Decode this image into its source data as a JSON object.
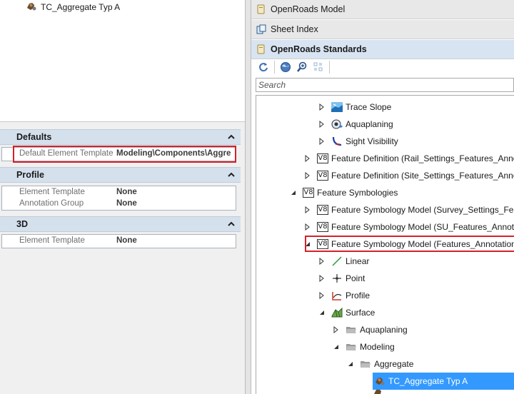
{
  "left_panel": {
    "top_item": {
      "label": "TC_Aggregate Typ A",
      "icon": "aggregate-icon"
    }
  },
  "properties": {
    "sections": [
      {
        "title": "Defaults",
        "rows": [
          {
            "label": "Default Element Template",
            "value": "Modeling\\Components\\Aggre"
          }
        ]
      },
      {
        "title": "Profile",
        "rows": [
          {
            "label": "Element Template",
            "value": "None"
          },
          {
            "label": "Annotation Group",
            "value": "None"
          }
        ]
      },
      {
        "title": "3D",
        "rows": [
          {
            "label": "Element Template",
            "value": "None"
          }
        ]
      }
    ]
  },
  "right_panel": {
    "tabs": [
      {
        "label": "OpenRoads Model",
        "icon": "dgn-file-icon"
      },
      {
        "label": "Sheet Index",
        "icon": "sheet-index-icon"
      },
      {
        "label": "OpenRoads Standards",
        "icon": "dgn-file-icon"
      }
    ],
    "toolbar": [
      "refresh-icon",
      "globe-icon",
      "zoom-icon",
      "grid-icon"
    ],
    "search_placeholder": "Search",
    "tree": [
      {
        "label": "Trace Slope",
        "icon": "trace-slope-icon",
        "expander": "collapsed"
      },
      {
        "label": "Aquaplaning",
        "icon": "aquaplaning-icon",
        "expander": "collapsed"
      },
      {
        "label": "Sight Visibility",
        "icon": "sight-visibility-icon",
        "expander": "collapsed"
      },
      {
        "label": "Feature Definition (Rail_Settings_Features_Annot",
        "icon": "v8-icon",
        "expander": "collapsed"
      },
      {
        "label": "Feature Definition (Site_Settings_Features_Annot",
        "icon": "v8-icon",
        "expander": "collapsed"
      },
      {
        "label": "Feature Symbologies",
        "icon": "v8-icon",
        "expander": "expanded"
      },
      {
        "label": "Feature Symbology Model (Survey_Settings_Feat",
        "icon": "v8-icon",
        "expander": "collapsed"
      },
      {
        "label": "Feature Symbology Model (SU_Features_Annotat",
        "icon": "v8-icon",
        "expander": "collapsed"
      },
      {
        "label": "Feature Symbology Model (Features_Annotation",
        "icon": "v8-icon",
        "expander": "expanded"
      },
      {
        "label": "Linear",
        "icon": "linear-icon",
        "expander": "collapsed"
      },
      {
        "label": "Point",
        "icon": "point-icon",
        "expander": "collapsed"
      },
      {
        "label": "Profile",
        "icon": "profile-icon",
        "expander": "collapsed"
      },
      {
        "label": "Surface",
        "icon": "surface-icon",
        "expander": "expanded"
      },
      {
        "label": "Aquaplaning",
        "icon": "folder-icon",
        "expander": "collapsed"
      },
      {
        "label": "Modeling",
        "icon": "folder-icon",
        "expander": "expanded"
      },
      {
        "label": "Aggregate",
        "icon": "folder-icon",
        "expander": "expanded"
      },
      {
        "label": "TC_Aggregate Typ A",
        "icon": "aggregate-icon",
        "expander": "none",
        "selected": true
      }
    ]
  },
  "colors": {
    "section_header": "#d5e0ed",
    "highlight_box": "#d6202a",
    "selection": "#3399ff"
  }
}
